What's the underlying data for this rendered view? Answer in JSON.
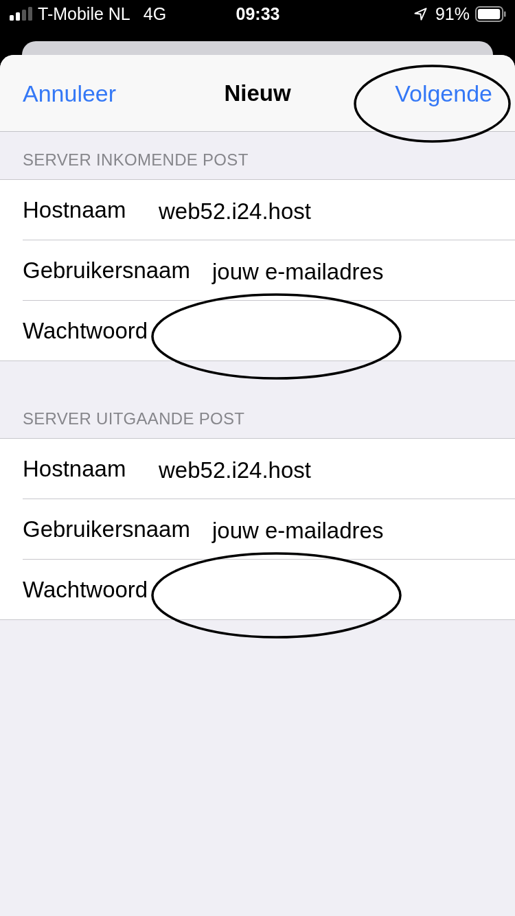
{
  "status_bar": {
    "carrier": "T-Mobile NL",
    "network": "4G",
    "time": "09:33",
    "battery": "91%"
  },
  "nav_bar": {
    "cancel": {
      "label": "Annuleer",
      "circled": false
    },
    "title": "Nieuw",
    "next": {
      "label": "Volgende",
      "circled": true
    }
  },
  "sections": [
    {
      "header": "SERVER INKOMENDE POST",
      "rows": [
        {
          "label": "Hostnaam",
          "value": "web52.i24.host",
          "circled": false
        },
        {
          "label": "Gebruikersnaam",
          "value": "jouw e-mailadres",
          "circled": false
        },
        {
          "label": "Wachtwoord",
          "circled": true
        }
      ]
    },
    {
      "header": "SERVER UITGAANDE POST",
      "rows": [
        {
          "label": "Hostnaam",
          "value": "web52.i24.host",
          "circled": false
        },
        {
          "label": "Gebruikersnaam",
          "value": "jouw e-mailadres",
          "circled": false
        },
        {
          "label": "Wachtwoord",
          "circled": true
        }
      ]
    }
  ]
}
